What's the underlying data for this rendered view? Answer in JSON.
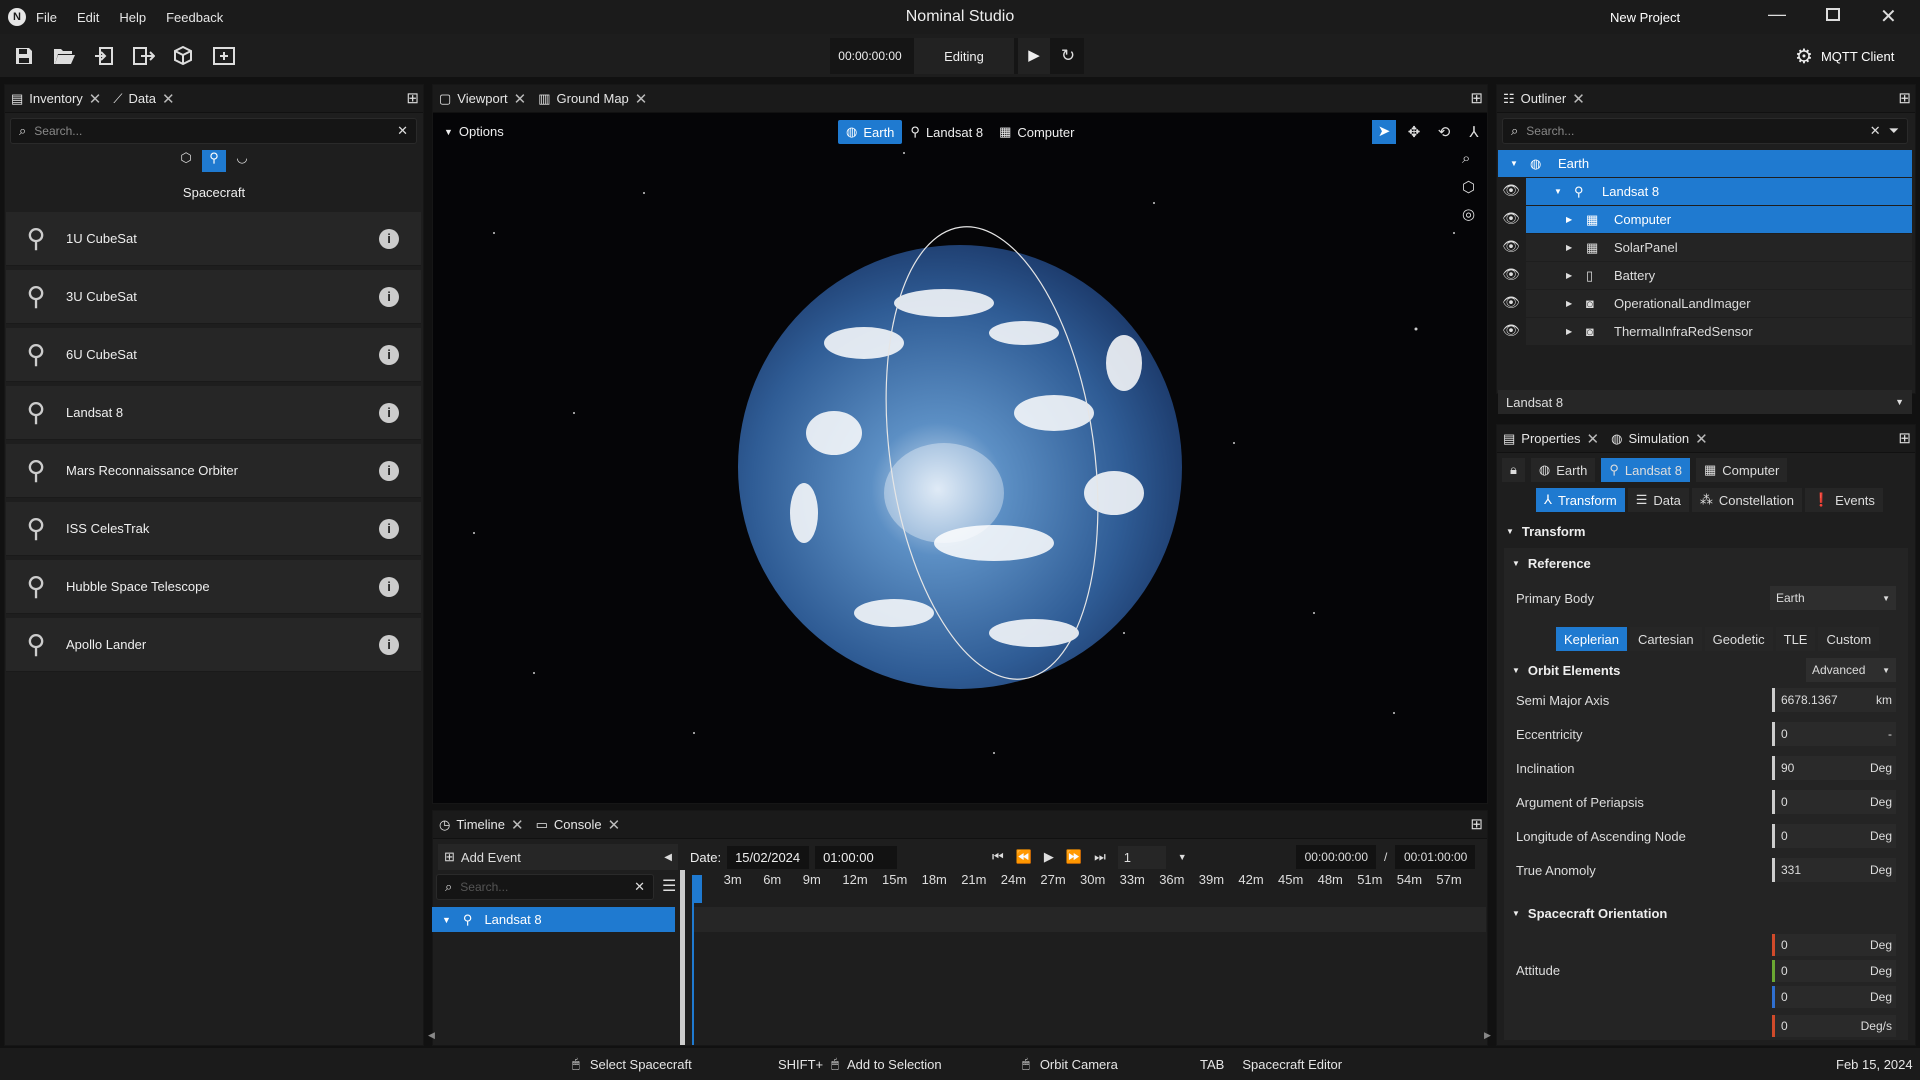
{
  "app": {
    "title": "Nominal Studio",
    "project": "New Project",
    "menu": [
      "File",
      "Edit",
      "Help",
      "Feedback"
    ]
  },
  "toolbar": {
    "time": "00:00:00:00",
    "mode": "Editing",
    "mqtt": "MQTT Client"
  },
  "left_panel": {
    "tabs": [
      {
        "label": "Inventory"
      },
      {
        "label": "Data"
      }
    ],
    "search_placeholder": "Search...",
    "category": "Spacecraft",
    "items": [
      {
        "label": "1U CubeSat"
      },
      {
        "label": "3U CubeSat"
      },
      {
        "label": "6U CubeSat"
      },
      {
        "label": "Landsat 8"
      },
      {
        "label": "Mars Reconnaissance Orbiter"
      },
      {
        "label": "ISS CelesTrak"
      },
      {
        "label": "Hubble Space Telescope"
      },
      {
        "label": "Apollo Lander"
      }
    ]
  },
  "viewport": {
    "tabs": [
      {
        "label": "Viewport"
      },
      {
        "label": "Ground Map"
      }
    ],
    "options": "Options",
    "breadcrumb": [
      {
        "label": "Earth"
      },
      {
        "label": "Landsat 8"
      },
      {
        "label": "Computer"
      }
    ]
  },
  "timeline": {
    "tabs": [
      {
        "label": "Timeline"
      },
      {
        "label": "Console"
      }
    ],
    "add_event": "Add Event",
    "search_placeholder": "Search...",
    "date_label": "Date:",
    "date": "15/02/2024",
    "time": "01:00:00",
    "speed": "1",
    "current": "00:00:00:00",
    "sep": "/",
    "end": "00:01:00:00",
    "ticks": [
      "3m",
      "6m",
      "9m",
      "12m",
      "15m",
      "18m",
      "21m",
      "24m",
      "27m",
      "30m",
      "33m",
      "36m",
      "39m",
      "42m",
      "45m",
      "48m",
      "51m",
      "54m",
      "57m"
    ],
    "track": "Landsat 8"
  },
  "outliner": {
    "tab": "Outliner",
    "search_placeholder": "Search...",
    "rows": [
      {
        "label": "Earth"
      },
      {
        "label": "Landsat 8"
      },
      {
        "label": "Computer"
      },
      {
        "label": "SolarPanel"
      },
      {
        "label": "Battery"
      },
      {
        "label": "OperationalLandImager"
      },
      {
        "label": "ThermalInfraRedSensor"
      }
    ],
    "selected": "Landsat 8"
  },
  "properties": {
    "tabs": [
      {
        "label": "Properties"
      },
      {
        "label": "Simulation"
      }
    ],
    "crumbs": [
      {
        "label": "Earth"
      },
      {
        "label": "Landsat 8"
      },
      {
        "label": "Computer"
      }
    ],
    "subtabs": [
      {
        "label": "Transform"
      },
      {
        "label": "Data"
      },
      {
        "label": "Constellation"
      },
      {
        "label": "Events"
      }
    ],
    "section": "Transform",
    "reference": "Reference",
    "primary_body_label": "Primary Body",
    "primary_body": "Earth",
    "modes": [
      {
        "label": "Keplerian"
      },
      {
        "label": "Cartesian"
      },
      {
        "label": "Geodetic"
      },
      {
        "label": "TLE"
      },
      {
        "label": "Custom"
      }
    ],
    "orbit_elements": "Orbit Elements",
    "orbit_mode": "Advanced",
    "fields": [
      {
        "label": "Semi Major Axis",
        "value": "6678.1367",
        "unit": "km"
      },
      {
        "label": "Eccentricity",
        "value": "0",
        "unit": "-"
      },
      {
        "label": "Inclination",
        "value": "90",
        "unit": "Deg"
      },
      {
        "label": "Argument of Periapsis",
        "value": "0",
        "unit": "Deg"
      },
      {
        "label": "Longitude of Ascending Node",
        "value": "0",
        "unit": "Deg"
      },
      {
        "label": "True Anomoly",
        "value": "331",
        "unit": "Deg"
      }
    ],
    "orientation": "Spacecraft Orientation",
    "attitude_label": "Attitude",
    "attitude": [
      {
        "value": "0",
        "unit": "Deg",
        "color": "#d04a2a"
      },
      {
        "value": "0",
        "unit": "Deg",
        "color": "#6aa832"
      },
      {
        "value": "0",
        "unit": "Deg",
        "color": "#2f6fd0"
      },
      {
        "value": "0",
        "unit": "Deg/s",
        "color": "#d04a2a"
      }
    ]
  },
  "status": {
    "hints": [
      {
        "key": "",
        "label": "Select Spacecraft"
      },
      {
        "key": "SHIFT+",
        "label": "Add to Selection"
      },
      {
        "key": "",
        "label": "Orbit Camera"
      },
      {
        "key": "TAB",
        "label": "Spacecraft Editor"
      }
    ],
    "date": "Feb 15, 2024"
  },
  "colors": {
    "accent": "#1f7ad0",
    "bg": "#1e1e1e"
  }
}
